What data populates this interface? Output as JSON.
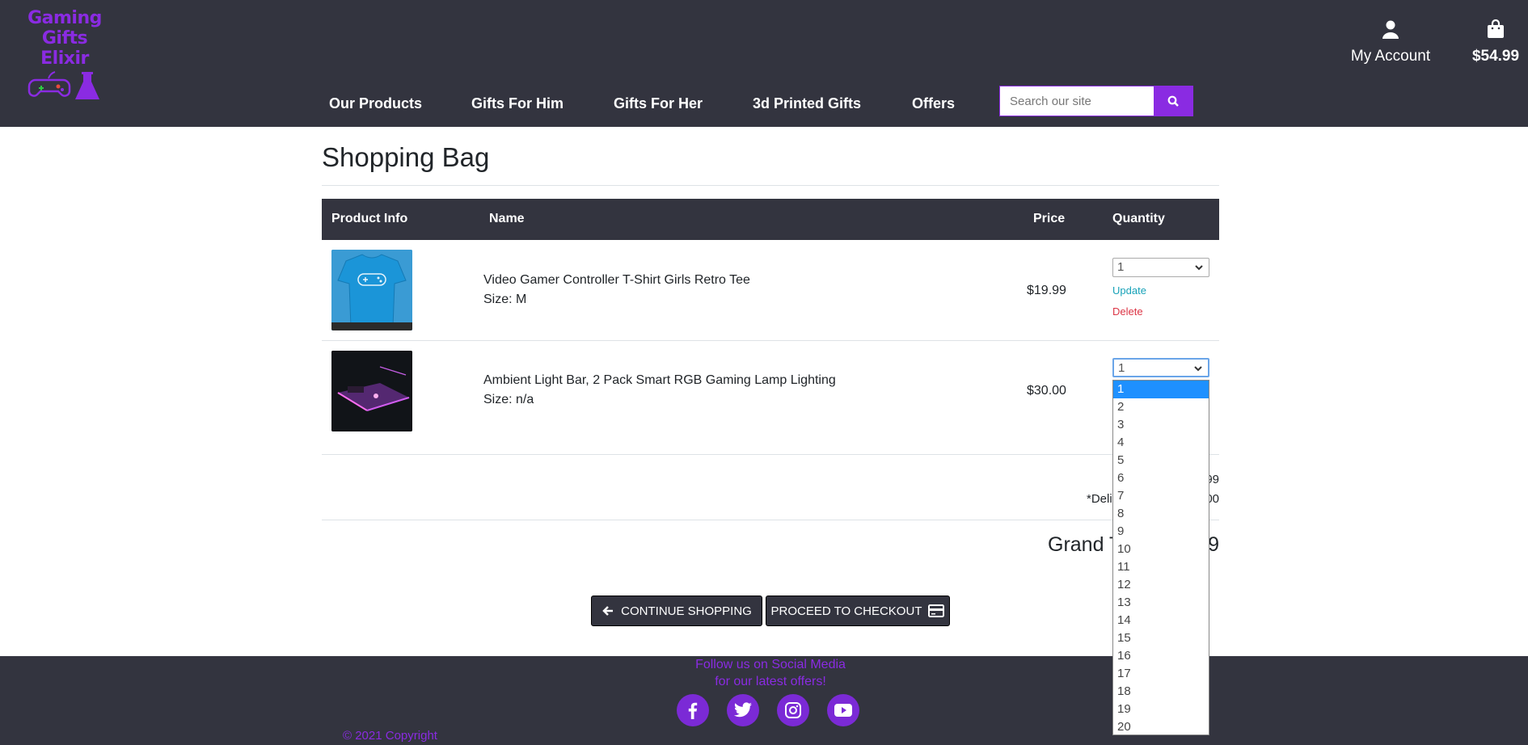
{
  "brand": {
    "line1": "Gaming Gifts",
    "line2": "Elixir",
    "accent": "#8a2be2",
    "header_bg": "#33343f"
  },
  "account": {
    "label": "My Account",
    "icon": "user-icon"
  },
  "bag": {
    "amount": "$54.99",
    "icon": "shopping-bag-icon"
  },
  "nav": {
    "items": [
      "Our Products",
      "Gifts For Him",
      "Gifts For Her",
      "3d Printed Gifts",
      "Offers"
    ]
  },
  "search": {
    "placeholder": "Search our site",
    "icon": "search-icon"
  },
  "page": {
    "title": "Shopping Bag"
  },
  "table": {
    "headers": {
      "product_info": "Product Info",
      "name": "Name",
      "price": "Price",
      "quantity": "Quantity"
    },
    "rows": [
      {
        "name": "Video Gamer Controller T-Shirt Girls Retro Tee",
        "size": "Size: M",
        "price": "$19.99",
        "qty": "1",
        "update": "Update",
        "delete": "Delete",
        "image": "blue-tshirt-image"
      },
      {
        "name": "Ambient Light Bar, 2 Pack Smart RGB Gaming Lamp Lighting",
        "size": "Size: n/a",
        "price": "$30.00",
        "qty": "1",
        "image": "rgb-light-bar-image"
      }
    ]
  },
  "summary": {
    "line1": "99",
    "line2_prefix": "*Deli",
    "line2_suffix": "00",
    "grand_prefix": "Grand T",
    "grand_suffix": "9"
  },
  "buttons": {
    "continue": "CONTINUE SHOPPING",
    "checkout": "PROCEED TO CHECKOUT"
  },
  "footer": {
    "follow1": "Follow us on Social Media",
    "follow2": "for our latest offers!",
    "copyright": "© 2021 Copyright",
    "social": [
      "facebook-icon",
      "twitter-icon",
      "instagram-icon",
      "youtube-icon"
    ]
  },
  "dropdown": {
    "options": [
      "1",
      "2",
      "3",
      "4",
      "5",
      "6",
      "7",
      "8",
      "9",
      "10",
      "11",
      "12",
      "13",
      "14",
      "15",
      "16",
      "17",
      "18",
      "19",
      "20"
    ],
    "selected": "1"
  }
}
